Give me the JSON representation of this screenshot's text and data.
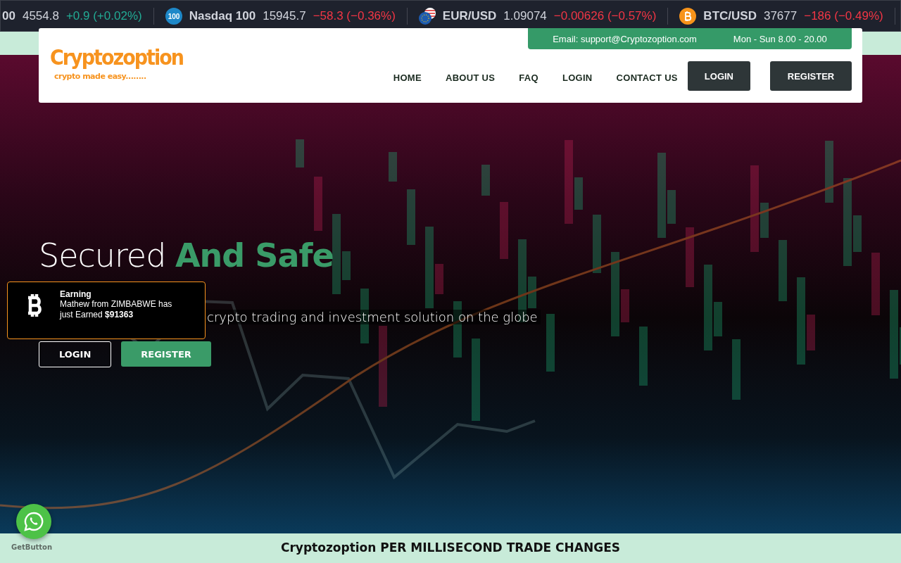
{
  "ticker": [
    {
      "kind": "plain",
      "name": "00",
      "price": "4554.8",
      "change": "+0.9 (+0.02%)",
      "color": "#22ab94"
    },
    {
      "kind": "index",
      "icon_text": "100",
      "name": "Nasdaq 100",
      "price": "15945.7",
      "change": "−58.3 (−0.36%)",
      "color": "#f23645"
    },
    {
      "kind": "forex",
      "name": "EUR/USD",
      "price": "1.09074",
      "change": "−0.00626 (−0.57%)",
      "color": "#f23645"
    },
    {
      "kind": "crypto",
      "name": "BTC/USD",
      "price": "37677",
      "change": "−186 (−0.49%)",
      "color": "#f23645"
    },
    {
      "kind": "brand"
    }
  ],
  "contact_bar": {
    "email": "Email: support@Cryptozoption.com",
    "hours": "Mon - Sun 8.00 - 20.00"
  },
  "logo": {
    "title": "Cryptozoption",
    "tagline": "crypto made easy........"
  },
  "nav": {
    "links": [
      "HOME",
      "ABOUT US",
      "FAQ",
      "LOGIN",
      "CONTACT US"
    ],
    "buttons": [
      "LOGIN",
      "REGISTER"
    ]
  },
  "hero": {
    "title_plain": "Secured",
    "title_accent": "And Safe",
    "subtitle": "crypto trading and investment solution on the globe",
    "buttons": [
      {
        "label": "LOGIN",
        "kind": "outline"
      },
      {
        "label": "REGISTER",
        "kind": "filled"
      }
    ]
  },
  "toast": {
    "title": "Earning",
    "message": "Mathew from ZIMBABWE has just Earned **$91363**"
  },
  "whatsapp": {
    "credit": "GetButton"
  },
  "section": {
    "title": "Cryptozoption PER MILLISECOND TRADE CHANGES"
  }
}
